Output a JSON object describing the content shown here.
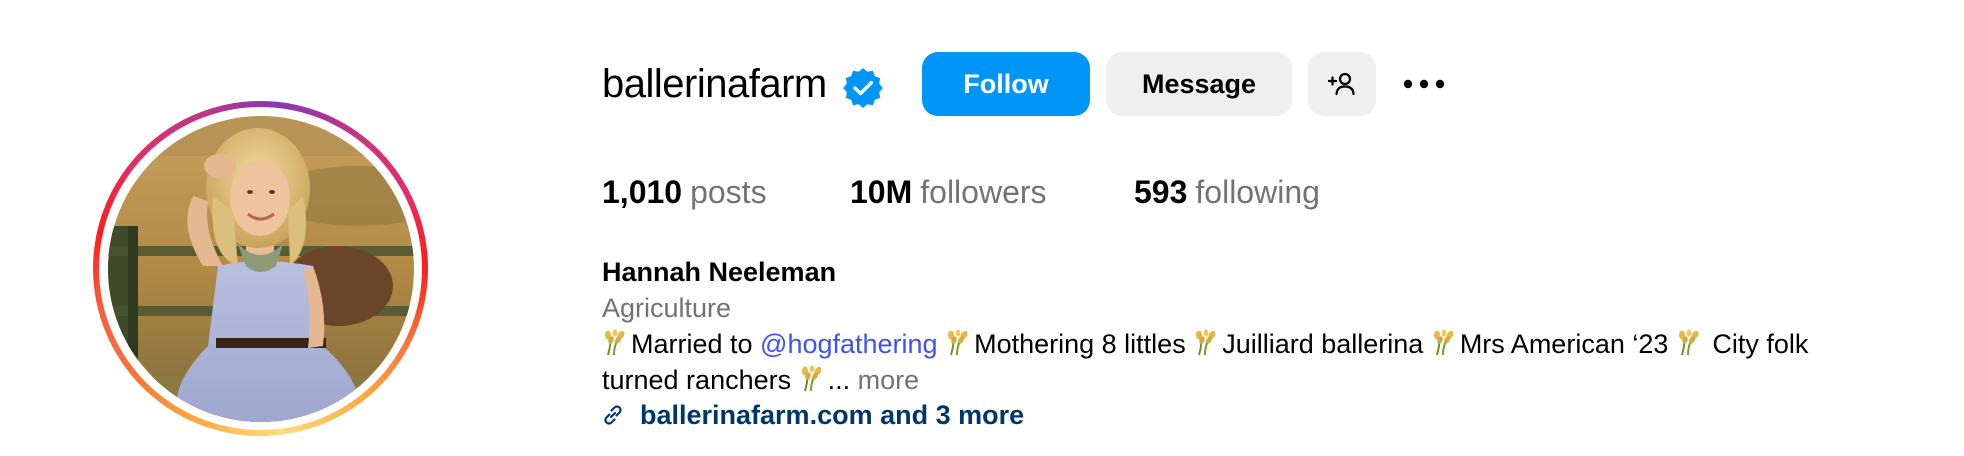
{
  "profile": {
    "username": "ballerinafarm",
    "verified": true,
    "full_name": "Hannah Neeleman",
    "category": "Agriculture"
  },
  "actions": {
    "follow_label": "Follow",
    "message_label": "Message"
  },
  "stats": {
    "posts_count": "1,010",
    "posts_label": "posts",
    "followers_count": "10M",
    "followers_label": "followers",
    "following_count": "593",
    "following_label": "following"
  },
  "bio": {
    "part1": "Married to ",
    "mention": "@hogfathering",
    "part2": " ",
    "part3": "Mothering 8 littles ",
    "part4": "Juilliard ballerina ",
    "part5": "Mrs American ‘23 ",
    "part6": " City folk turned ranchers ",
    "ellipsis": "... ",
    "more_label": "more",
    "emoji_icon": "wheat-sheaf-icon"
  },
  "links": {
    "text": "ballerinafarm.com and 3 more",
    "icon": "link-icon"
  },
  "colors": {
    "follow_button": "#0095f6",
    "secondary_button": "#efefef",
    "verified_badge": "#0095f6",
    "mention": "#4150f7",
    "link": "#00376b",
    "muted_text": "#737373"
  }
}
